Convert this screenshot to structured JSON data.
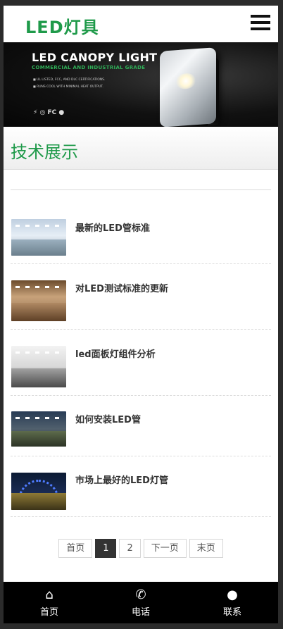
{
  "header": {
    "logo": "LED灯具",
    "menu_icon": "hamburger-icon"
  },
  "banner": {
    "title": "LED CANOPY LIGHT",
    "subtitle": "COMMERCIAL AND INDUSTRIAL GRADE",
    "bullets": [
      "UL LISTED, FCC, AND DLC CERTIFICATIONS.",
      "RUNS COOL WITH MINIMAL HEAT OUTPUT."
    ],
    "certs": "⚡ ◎ FC ●"
  },
  "section": {
    "title": "技术展示"
  },
  "articles": [
    {
      "title": "最新的LED管标准"
    },
    {
      "title": "对LED测试标准的更新"
    },
    {
      "title": "led面板灯组件分析"
    },
    {
      "title": "如何安装LED管"
    },
    {
      "title": "市场上最好的LED灯管"
    }
  ],
  "pagination": {
    "first": "首页",
    "page1": "1",
    "page2": "2",
    "next": "下一页",
    "last": "末页",
    "current": 1
  },
  "bottom_nav": {
    "home": {
      "label": "首页",
      "icon": "home-icon",
      "glyph": "⌂"
    },
    "phone": {
      "label": "电话",
      "icon": "phone-icon",
      "glyph": "✆"
    },
    "contact": {
      "label": "联系",
      "icon": "user-icon",
      "glyph": "●"
    }
  },
  "colors": {
    "brand_green": "#1f9a4a",
    "nav_bg": "#000000",
    "active_page": "#333333"
  }
}
